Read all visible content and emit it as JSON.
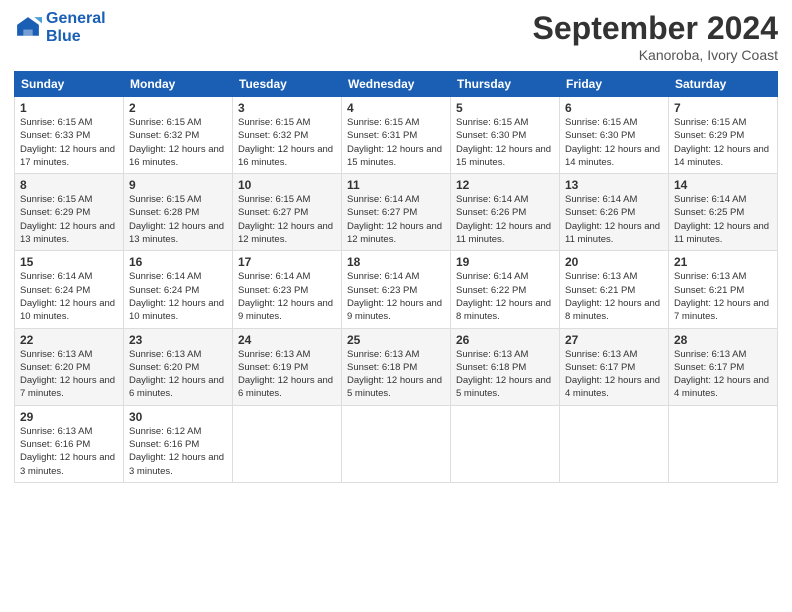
{
  "logo": {
    "line1": "General",
    "line2": "Blue"
  },
  "title": "September 2024",
  "location": "Kanoroba, Ivory Coast",
  "weekdays": [
    "Sunday",
    "Monday",
    "Tuesday",
    "Wednesday",
    "Thursday",
    "Friday",
    "Saturday"
  ],
  "weeks": [
    [
      {
        "day": "1",
        "sunrise": "6:15 AM",
        "sunset": "6:33 PM",
        "daylight": "12 hours and 17 minutes."
      },
      {
        "day": "2",
        "sunrise": "6:15 AM",
        "sunset": "6:32 PM",
        "daylight": "12 hours and 16 minutes."
      },
      {
        "day": "3",
        "sunrise": "6:15 AM",
        "sunset": "6:32 PM",
        "daylight": "12 hours and 16 minutes."
      },
      {
        "day": "4",
        "sunrise": "6:15 AM",
        "sunset": "6:31 PM",
        "daylight": "12 hours and 15 minutes."
      },
      {
        "day": "5",
        "sunrise": "6:15 AM",
        "sunset": "6:30 PM",
        "daylight": "12 hours and 15 minutes."
      },
      {
        "day": "6",
        "sunrise": "6:15 AM",
        "sunset": "6:30 PM",
        "daylight": "12 hours and 14 minutes."
      },
      {
        "day": "7",
        "sunrise": "6:15 AM",
        "sunset": "6:29 PM",
        "daylight": "12 hours and 14 minutes."
      }
    ],
    [
      {
        "day": "8",
        "sunrise": "6:15 AM",
        "sunset": "6:29 PM",
        "daylight": "12 hours and 13 minutes."
      },
      {
        "day": "9",
        "sunrise": "6:15 AM",
        "sunset": "6:28 PM",
        "daylight": "12 hours and 13 minutes."
      },
      {
        "day": "10",
        "sunrise": "6:15 AM",
        "sunset": "6:27 PM",
        "daylight": "12 hours and 12 minutes."
      },
      {
        "day": "11",
        "sunrise": "6:14 AM",
        "sunset": "6:27 PM",
        "daylight": "12 hours and 12 minutes."
      },
      {
        "day": "12",
        "sunrise": "6:14 AM",
        "sunset": "6:26 PM",
        "daylight": "12 hours and 11 minutes."
      },
      {
        "day": "13",
        "sunrise": "6:14 AM",
        "sunset": "6:26 PM",
        "daylight": "12 hours and 11 minutes."
      },
      {
        "day": "14",
        "sunrise": "6:14 AM",
        "sunset": "6:25 PM",
        "daylight": "12 hours and 11 minutes."
      }
    ],
    [
      {
        "day": "15",
        "sunrise": "6:14 AM",
        "sunset": "6:24 PM",
        "daylight": "12 hours and 10 minutes."
      },
      {
        "day": "16",
        "sunrise": "6:14 AM",
        "sunset": "6:24 PM",
        "daylight": "12 hours and 10 minutes."
      },
      {
        "day": "17",
        "sunrise": "6:14 AM",
        "sunset": "6:23 PM",
        "daylight": "12 hours and 9 minutes."
      },
      {
        "day": "18",
        "sunrise": "6:14 AM",
        "sunset": "6:23 PM",
        "daylight": "12 hours and 9 minutes."
      },
      {
        "day": "19",
        "sunrise": "6:14 AM",
        "sunset": "6:22 PM",
        "daylight": "12 hours and 8 minutes."
      },
      {
        "day": "20",
        "sunrise": "6:13 AM",
        "sunset": "6:21 PM",
        "daylight": "12 hours and 8 minutes."
      },
      {
        "day": "21",
        "sunrise": "6:13 AM",
        "sunset": "6:21 PM",
        "daylight": "12 hours and 7 minutes."
      }
    ],
    [
      {
        "day": "22",
        "sunrise": "6:13 AM",
        "sunset": "6:20 PM",
        "daylight": "12 hours and 7 minutes."
      },
      {
        "day": "23",
        "sunrise": "6:13 AM",
        "sunset": "6:20 PM",
        "daylight": "12 hours and 6 minutes."
      },
      {
        "day": "24",
        "sunrise": "6:13 AM",
        "sunset": "6:19 PM",
        "daylight": "12 hours and 6 minutes."
      },
      {
        "day": "25",
        "sunrise": "6:13 AM",
        "sunset": "6:18 PM",
        "daylight": "12 hours and 5 minutes."
      },
      {
        "day": "26",
        "sunrise": "6:13 AM",
        "sunset": "6:18 PM",
        "daylight": "12 hours and 5 minutes."
      },
      {
        "day": "27",
        "sunrise": "6:13 AM",
        "sunset": "6:17 PM",
        "daylight": "12 hours and 4 minutes."
      },
      {
        "day": "28",
        "sunrise": "6:13 AM",
        "sunset": "6:17 PM",
        "daylight": "12 hours and 4 minutes."
      }
    ],
    [
      {
        "day": "29",
        "sunrise": "6:13 AM",
        "sunset": "6:16 PM",
        "daylight": "12 hours and 3 minutes."
      },
      {
        "day": "30",
        "sunrise": "6:12 AM",
        "sunset": "6:16 PM",
        "daylight": "12 hours and 3 minutes."
      },
      null,
      null,
      null,
      null,
      null
    ]
  ]
}
